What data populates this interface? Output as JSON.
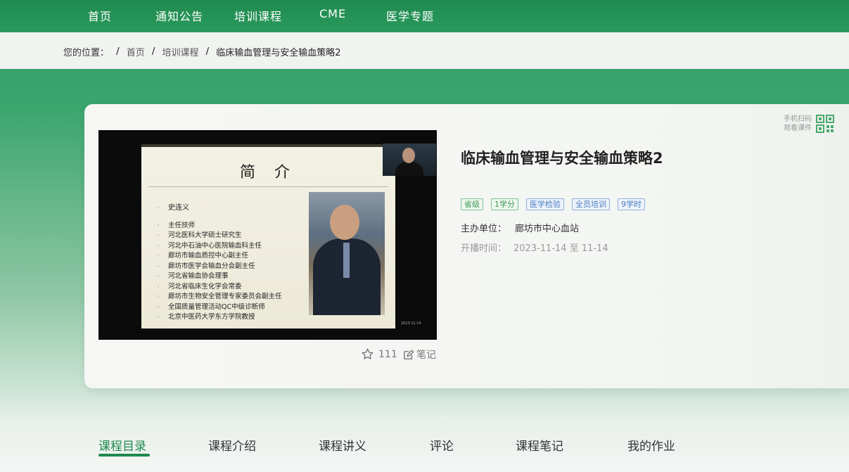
{
  "nav": {
    "items": [
      "首页",
      "通知公告",
      "培训课程",
      "CME",
      "医学专题"
    ]
  },
  "breadcrumb": {
    "prefix": "您的位置：",
    "sep": "/",
    "items": [
      "首页",
      "培训课程",
      "临床输血管理与安全输血策略2"
    ]
  },
  "video": {
    "slide": {
      "title": "简 介",
      "name": "史连义",
      "lines": [
        "主任技师",
        "河北医科大学硕士研究生",
        "河北中石油中心医院输血科主任",
        "廊坊市输血质控中心副主任",
        "廊坊市医学会输血分会副主任",
        "河北省输血协会理事",
        "河北省临床生化学会常委",
        "廊坊市生物安全管理专家委员会副主任",
        "全国质量管理活动QC中级诊断师",
        "北京中医药大学东方学院教授"
      ]
    },
    "stamp": "2023·11·14"
  },
  "actions": {
    "likes": "111",
    "notes_label": "笔记"
  },
  "course": {
    "title": "临床输血管理与安全输血策略2",
    "tags": [
      {
        "label": "省级",
        "color": "green"
      },
      {
        "label": "1学分",
        "color": "green"
      },
      {
        "label": "医学检验",
        "color": "blue"
      },
      {
        "label": "全员培训",
        "color": "blue"
      },
      {
        "label": "9学时",
        "color": "blue"
      }
    ],
    "organizer_label": "主办单位：",
    "organizer_value": "廊坊市中心血站",
    "airtime_label": "开播时间：",
    "airtime_value": "2023-11-14 至 11-14"
  },
  "qr": {
    "line1": "手机扫码",
    "line2": "观看课件",
    "icon": "qr-code-icon"
  },
  "tabs": [
    "课程目录",
    "课程介绍",
    "课程讲义",
    "评论",
    "课程笔记",
    "我的作业"
  ],
  "colors": {
    "primary_green": "#1e8a4c",
    "tag_green": "#3d9a55",
    "tag_blue": "#4a7fc1"
  }
}
